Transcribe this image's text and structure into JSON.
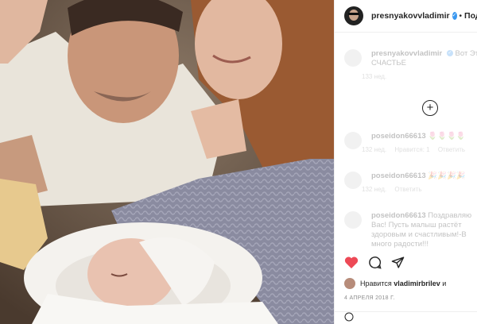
{
  "header": {
    "username": "presnyakovvladimir",
    "dot": "•",
    "follow_label": "Подп"
  },
  "caption": {
    "username": "presnyakovvladimir",
    "text_line1": "Вот Эт",
    "text_line2": "СЧАСТЬЕ",
    "time": "133 нед."
  },
  "comments": [
    {
      "username": "poseidon66613",
      "text": "🌷🌷🌷🌷",
      "time": "132 нед.",
      "likes": "Нравится: 1",
      "reply": "Ответить"
    },
    {
      "username": "poseidon66613",
      "text": "🎉🎉🎉🎉",
      "time": "132 нед.",
      "likes": "",
      "reply": "Ответить"
    },
    {
      "username": "poseidon66613",
      "text": "Поздравляю",
      "text_line2": "Вас! Пусть малыш растёт",
      "text_line3": "здоровым и счастливым!-В",
      "text_line4": "много радости!!!"
    }
  ],
  "likes": {
    "prefix": "Нравится",
    "user": "vladimirbrilev",
    "suffix": "и"
  },
  "date": "4 АПРЕЛЯ 2018 Г.",
  "colors": {
    "verified": "#3897f0",
    "text": "#262626",
    "muted": "#8e8e8e"
  },
  "icons": [
    "heart-icon",
    "comment-icon",
    "share-icon",
    "plus-circle-icon",
    "verified-icon",
    "emoji-icon"
  ]
}
